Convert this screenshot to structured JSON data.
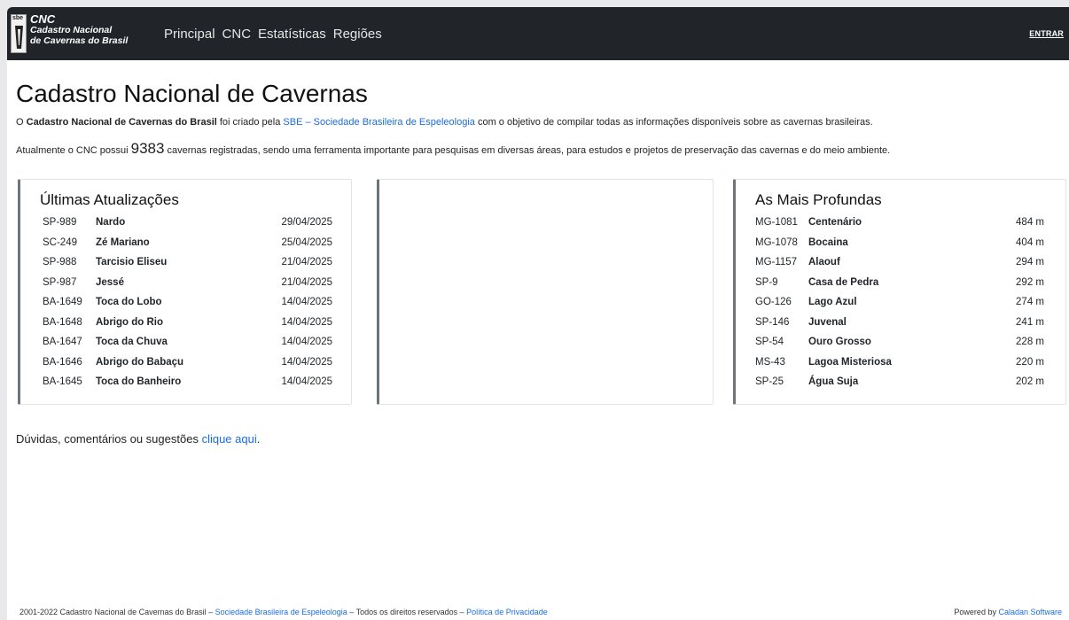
{
  "nav": {
    "logo": {
      "title": "CNC",
      "line1": "Cadastro Nacional",
      "line2": "de Cavernas do Brasil",
      "badge": "sbe"
    },
    "links": [
      "Principal",
      "CNC",
      "Estatísticas",
      "Regiões"
    ],
    "login": "ENTRAR"
  },
  "page": {
    "title": "Cadastro Nacional de Cavernas",
    "intro_prefix": "O ",
    "intro_bold": "Cadastro Nacional de Cavernas do Brasil",
    "intro_mid": " foi criado pela ",
    "intro_link": "SBE – Sociedade Brasileira de Espeleologia",
    "intro_suffix": " com o objetivo de compilar todas as informações disponíveis sobre as cavernas brasileiras.",
    "stats_prefix": "Atualmente o CNC possui ",
    "stats_count": "9383",
    "stats_suffix": " cavernas registradas, sendo uma ferramenta importante para pesquisas em diversas áreas, para estudos e projetos de preservação das cavernas e do meio ambiente."
  },
  "updates": {
    "title": "Últimas Atualizações",
    "rows": [
      {
        "code": "SP-989",
        "name": "Nardo",
        "date": "29/04/2025"
      },
      {
        "code": "SC-249",
        "name": "Zé Mariano",
        "date": "25/04/2025"
      },
      {
        "code": "SP-988",
        "name": "Tarcisio Eliseu",
        "date": "21/04/2025"
      },
      {
        "code": "SP-987",
        "name": "Jessé",
        "date": "21/04/2025"
      },
      {
        "code": "BA-1649",
        "name": "Toca do Lobo",
        "date": "14/04/2025"
      },
      {
        "code": "BA-1648",
        "name": "Abrigo do Rio",
        "date": "14/04/2025"
      },
      {
        "code": "BA-1647",
        "name": "Toca da Chuva",
        "date": "14/04/2025"
      },
      {
        "code": "BA-1646",
        "name": "Abrigo do Babaçu",
        "date": "14/04/2025"
      },
      {
        "code": "BA-1645",
        "name": "Toca do Banheiro",
        "date": "14/04/2025"
      }
    ]
  },
  "deepest": {
    "title": "As Mais Profundas",
    "rows": [
      {
        "code": "MG-1081",
        "name": "Centenário",
        "depth": "484 m"
      },
      {
        "code": "MG-1078",
        "name": "Bocaina",
        "depth": "404 m"
      },
      {
        "code": "MG-1157",
        "name": "Alaouf",
        "depth": "294 m"
      },
      {
        "code": "SP-9",
        "name": "Casa de Pedra",
        "depth": "292 m"
      },
      {
        "code": "GO-126",
        "name": "Lago Azul",
        "depth": "274 m"
      },
      {
        "code": "SP-146",
        "name": "Juvenal",
        "depth": "241 m"
      },
      {
        "code": "SP-54",
        "name": "Ouro Grosso",
        "depth": "228 m"
      },
      {
        "code": "MS-43",
        "name": "Lagoa Misteriosa",
        "depth": "220 m"
      },
      {
        "code": "SP-25",
        "name": "Água Suja",
        "depth": "202 m"
      }
    ]
  },
  "contact": {
    "text": "Dúvidas, comentários ou sugestões ",
    "link": "clique aqui",
    "end": "."
  },
  "footer": {
    "prefix": "2001-2022 Cadastro Nacional de Cavernas do Brasil – ",
    "link1": "Sociedade Brasileira de Espeleologia",
    "mid": " – Todos os direitos reservados – ",
    "link2": "Política de Privacidade",
    "powered_prefix": "Powered by ",
    "powered_link": "Caladan Software"
  },
  "colors": {
    "navbar": "#212529",
    "link": "#1a6de0",
    "panel_accent": "#6c757d"
  }
}
